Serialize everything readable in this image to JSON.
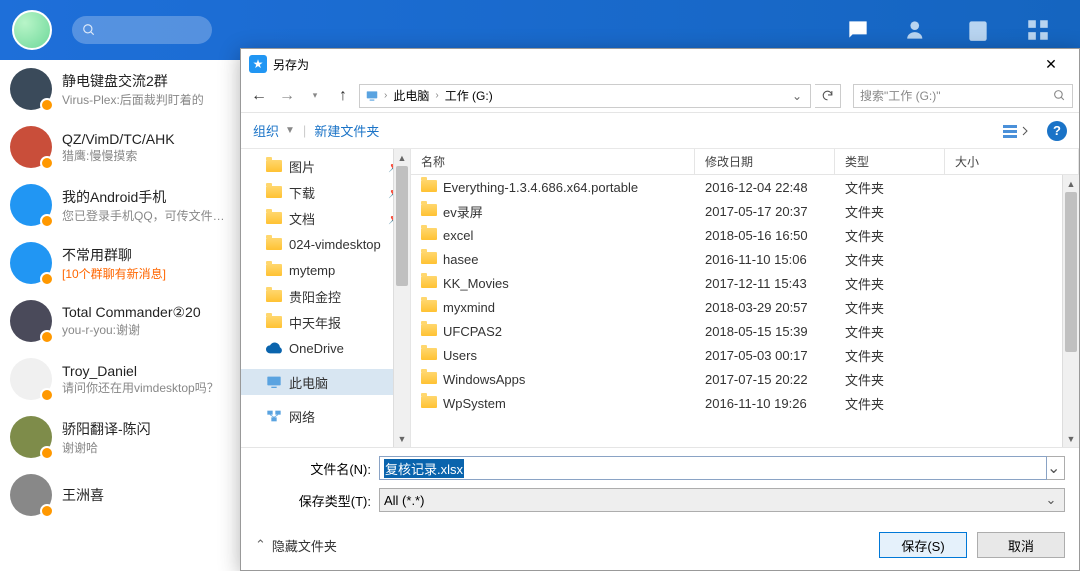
{
  "header": {
    "icons": [
      "chat",
      "contacts",
      "apps",
      "more"
    ]
  },
  "contacts": [
    {
      "name": "静电键盘交流2群",
      "sub": "Virus-Plex:后面裁判盯着的",
      "avatar_bg": "#3a4a5a"
    },
    {
      "name": "QZ/VimD/TC/AHK",
      "sub": "猎鹰:慢慢摸索",
      "avatar_bg": "#c94e3a"
    },
    {
      "name": "我的Android手机",
      "sub": "您已登录手机QQ，可传文件…",
      "avatar_bg": "#2196f3"
    },
    {
      "name": "不常用群聊",
      "sub": "[10个群聊有新消息]",
      "avatar_bg": "#2196f3",
      "orange": true
    },
    {
      "name": "Total Commander②20",
      "sub": "you-r-you:谢谢",
      "avatar_bg": "#4a4a5a"
    },
    {
      "name": "Troy_Daniel",
      "sub": "请问你还在用vimdesktop吗？",
      "avatar_bg": "#f0f0f0"
    },
    {
      "name": "骄阳翻译-陈闪",
      "sub": "谢谢哈",
      "avatar_bg": "#7e8c4a"
    },
    {
      "name": "王洲喜",
      "sub": "",
      "avatar_bg": "#888"
    }
  ],
  "dialog": {
    "title": "另存为",
    "breadcrumb": [
      "此电脑",
      "工作 (G:)"
    ],
    "search_placeholder": "搜索\"工作 (G:)\"",
    "toolbar": {
      "organize": "组织",
      "new_folder": "新建文件夹"
    },
    "tree": [
      {
        "label": "图片",
        "icon": "folder",
        "pin": true
      },
      {
        "label": "下载",
        "icon": "folder",
        "pin": true
      },
      {
        "label": "文档",
        "icon": "folder",
        "pin": true
      },
      {
        "label": "024-vimdesktop",
        "icon": "folder"
      },
      {
        "label": "mytemp",
        "icon": "folder"
      },
      {
        "label": "贵阳金控",
        "icon": "folder"
      },
      {
        "label": "中天年报",
        "icon": "folder"
      },
      {
        "label": "OneDrive",
        "icon": "onedrive"
      },
      {
        "label": "此电脑",
        "icon": "pc",
        "selected": true
      },
      {
        "label": "网络",
        "icon": "network"
      }
    ],
    "columns": {
      "name": "名称",
      "date": "修改日期",
      "type": "类型",
      "size": "大小"
    },
    "files": [
      {
        "name": "Everything-1.3.4.686.x64.portable",
        "date": "2016-12-04 22:48",
        "type": "文件夹"
      },
      {
        "name": "ev录屏",
        "date": "2017-05-17 20:37",
        "type": "文件夹"
      },
      {
        "name": "excel",
        "date": "2018-05-16 16:50",
        "type": "文件夹"
      },
      {
        "name": "hasee",
        "date": "2016-11-10 15:06",
        "type": "文件夹"
      },
      {
        "name": "KK_Movies",
        "date": "2017-12-11 15:43",
        "type": "文件夹"
      },
      {
        "name": "myxmind",
        "date": "2018-03-29 20:57",
        "type": "文件夹"
      },
      {
        "name": "UFCPAS2",
        "date": "2018-05-15 15:39",
        "type": "文件夹"
      },
      {
        "name": "Users",
        "date": "2017-05-03 00:17",
        "type": "文件夹"
      },
      {
        "name": "WindowsApps",
        "date": "2017-07-15 20:22",
        "type": "文件夹"
      },
      {
        "name": "WpSystem",
        "date": "2016-11-10 19:26",
        "type": "文件夹"
      }
    ],
    "filename_label": "文件名(N):",
    "filename_value": "复核记录.xlsx",
    "filetype_label": "保存类型(T):",
    "filetype_value": "All (*.*)",
    "hide_folders": "隐藏文件夹",
    "save": "保存(S)",
    "cancel": "取消"
  }
}
